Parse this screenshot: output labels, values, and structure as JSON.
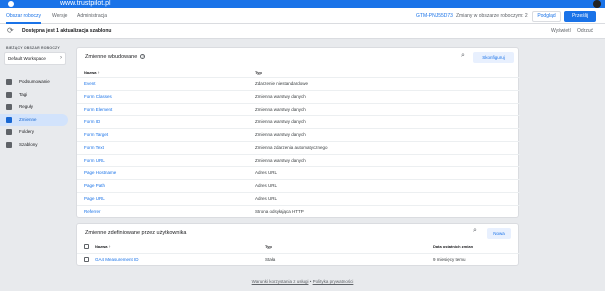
{
  "browser": {
    "url": "www.trustpilot.pl"
  },
  "topnav": {
    "tabs": [
      {
        "label": "Obszar roboczy",
        "active": true
      },
      {
        "label": "Wersje",
        "active": false
      },
      {
        "label": "Administracja",
        "active": false
      }
    ],
    "container_id": "GTM-PNJ55D73",
    "changes": "Zmiany w obszarze roboczym: 2",
    "preview": "Podgląd",
    "submit": "Prześlij"
  },
  "notice": {
    "text": "Dostępna jest 1 aktualizacja szablonu",
    "view": "Wyświetl",
    "dismiss": "Odrzuć"
  },
  "sidebar": {
    "workspace_label": "BIEŻĄCY OBSZAR ROBOCZY",
    "workspace_value": "Default Workspace",
    "items": [
      {
        "label": "Podsumowanie",
        "active": false
      },
      {
        "label": "Tagi",
        "active": false
      },
      {
        "label": "Reguły",
        "active": false
      },
      {
        "label": "Zmienne",
        "active": true
      },
      {
        "label": "Foldery",
        "active": false
      },
      {
        "label": "Szablony",
        "active": false
      }
    ]
  },
  "builtin": {
    "title": "Zmienne wbudowane",
    "configure": "Skonfiguruj",
    "col_name": "Nazwa",
    "col_type": "Typ",
    "rows": [
      {
        "name": "Event",
        "type": "Zdarzenie niestandardowe"
      },
      {
        "name": "Form Classes",
        "type": "Zmienna warstwy danych"
      },
      {
        "name": "Form Element",
        "type": "Zmienna warstwy danych"
      },
      {
        "name": "Form ID",
        "type": "Zmienna warstwy danych"
      },
      {
        "name": "Form Target",
        "type": "Zmienna warstwy danych"
      },
      {
        "name": "Form Text",
        "type": "Zmienna zdarzenia automatycznego"
      },
      {
        "name": "Form URL",
        "type": "Zmienna warstwy danych"
      },
      {
        "name": "Page Hostname",
        "type": "Adres URL"
      },
      {
        "name": "Page Path",
        "type": "Adres URL"
      },
      {
        "name": "Page URL",
        "type": "Adres URL"
      },
      {
        "name": "Referrer",
        "type": "Strona odsyłająca HTTP"
      }
    ]
  },
  "user": {
    "title": "Zmienne zdefiniowane przez użytkownika",
    "new": "Nowa",
    "col_name": "Nazwa",
    "col_type": "Typ",
    "col_edit": "Data ostatnich zmian",
    "rows": [
      {
        "name": "GA4 Measurement ID",
        "type": "Stała",
        "edited": "9 miesięcy temu"
      }
    ]
  },
  "footer": {
    "terms": "Warunki korzystania z usługi",
    "sep": "•",
    "privacy": "Polityka prywatności"
  }
}
